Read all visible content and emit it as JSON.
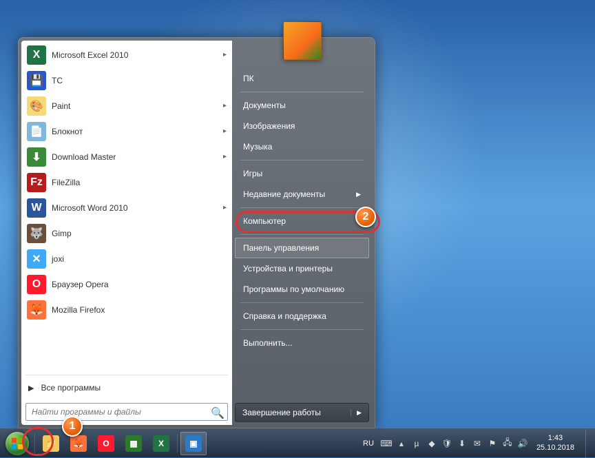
{
  "programs": [
    {
      "label": "Microsoft Excel 2010",
      "icon_bg": "#217346",
      "icon_text": "X",
      "has_submenu": true
    },
    {
      "label": "TC",
      "icon_bg": "#2b55c9",
      "icon_text": "💾",
      "has_submenu": false
    },
    {
      "label": "Paint",
      "icon_bg": "#f5d97a",
      "icon_text": "🎨",
      "has_submenu": true
    },
    {
      "label": "Блокнот",
      "icon_bg": "#7fb8da",
      "icon_text": "📄",
      "has_submenu": true
    },
    {
      "label": "Download Master",
      "icon_bg": "#3a8a3a",
      "icon_text": "⬇",
      "has_submenu": true
    },
    {
      "label": "FileZilla",
      "icon_bg": "#b71c1c",
      "icon_text": "Fz",
      "has_submenu": false
    },
    {
      "label": "Microsoft Word 2010",
      "icon_bg": "#2b579a",
      "icon_text": "W",
      "has_submenu": true
    },
    {
      "label": "Gimp",
      "icon_bg": "#6b4f3a",
      "icon_text": "🐺",
      "has_submenu": false
    },
    {
      "label": "joxi",
      "icon_bg": "#3fa9f5",
      "icon_text": "✕",
      "has_submenu": false
    },
    {
      "label": "Браузер Opera",
      "icon_bg": "#ff1b2d",
      "icon_text": "O",
      "has_submenu": false
    },
    {
      "label": "Mozilla Firefox",
      "icon_bg": "#ff7139",
      "icon_text": "🦊",
      "has_submenu": false
    }
  ],
  "all_programs": "Все программы",
  "search": {
    "placeholder": "Найти программы и файлы"
  },
  "right_items": [
    {
      "label": "ПК",
      "submenu": false
    },
    {
      "label": "Документы",
      "submenu": false
    },
    {
      "label": "Изображения",
      "submenu": false
    },
    {
      "label": "Музыка",
      "submenu": false
    },
    {
      "label": "Игры",
      "submenu": false
    },
    {
      "label": "Недавние документы",
      "submenu": true
    },
    {
      "label": "Компьютер",
      "submenu": false
    },
    {
      "label": "Панель управления",
      "submenu": false
    },
    {
      "label": "Устройства и принтеры",
      "submenu": false
    },
    {
      "label": "Программы по умолчанию",
      "submenu": false
    },
    {
      "label": "Справка и поддержка",
      "submenu": false
    },
    {
      "label": "Выполнить...",
      "submenu": false
    }
  ],
  "highlighted_right_index": 7,
  "shutdown": "Завершение работы",
  "markers": {
    "1": "1",
    "2": "2"
  },
  "lang": "RU",
  "clock": {
    "time": "1:43",
    "date": "25.10.2018"
  }
}
